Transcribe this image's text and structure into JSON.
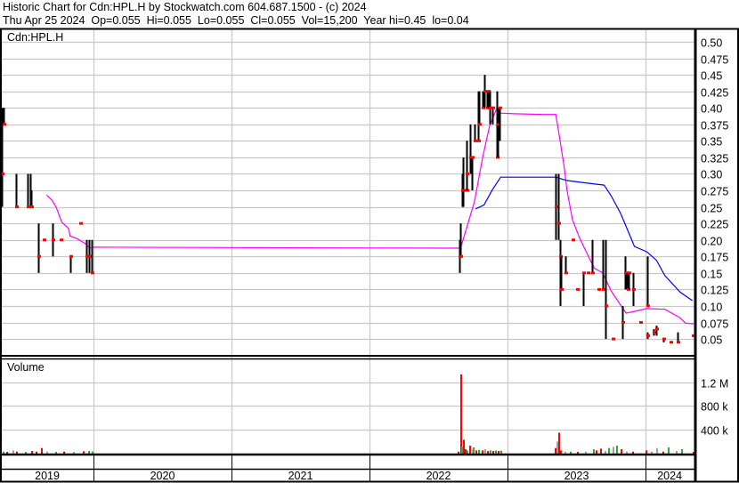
{
  "header": {
    "title": "Historic Chart for Cdn:HPL.H by Stockwatch.com 604.687.1500 - (c) 2024",
    "quote": "Thu Apr 25 2024  Op=0.055  Hi=0.055  Lo=0.055  Cl=0.055  Vol=15,200  Year hi=0.45  lo=0.04"
  },
  "colors": {
    "bar": "#000000",
    "close": "#ff0000",
    "ma_short": "#ff00ff",
    "ma_long": "#0000ff",
    "vol_down": "#ff0000",
    "vol_up": "#33aa33",
    "vol_flat": "#a0a0a0",
    "grid": "#c8c8c8"
  },
  "chart_data": [
    {
      "type": "line",
      "title": "Cdn:HPL.H",
      "x_unit": "year",
      "xlim": [
        2019.33,
        2024.35
      ],
      "ylim": [
        0.025,
        0.5
      ],
      "y_ticks": [
        "0.50",
        "0.475",
        "0.45",
        "0.425",
        "0.40",
        "0.375",
        "0.35",
        "0.325",
        "0.30",
        "0.275",
        "0.25",
        "0.225",
        "0.20",
        "0.175",
        "0.15",
        "0.125",
        "0.10",
        "0.075",
        "0.05"
      ],
      "x_ticks": [
        "2019",
        "2020",
        "2021",
        "2022",
        "2023",
        "2024"
      ],
      "ohlc_bars_year_high_low_close": [
        [
          2019.335,
          0.4,
          0.25,
          0.3
        ],
        [
          2019.35,
          0.4,
          0.375,
          0.375
        ],
        [
          2019.44,
          0.3,
          0.25,
          0.25
        ],
        [
          2019.52,
          0.3,
          0.25,
          0.25
        ],
        [
          2019.54,
          0.3,
          0.25,
          0.25
        ],
        [
          2019.55,
          0.275,
          0.25,
          0.25
        ],
        [
          2019.6,
          0.225,
          0.15,
          0.175
        ],
        [
          2019.64,
          0.2,
          0.2,
          0.2
        ],
        [
          2019.7,
          0.225,
          0.175,
          0.2
        ],
        [
          2019.76,
          0.2,
          0.2,
          0.2
        ],
        [
          2019.83,
          0.175,
          0.15,
          0.175
        ],
        [
          2019.9,
          0.225,
          0.225,
          0.225
        ],
        [
          2019.95,
          0.2,
          0.15,
          0.175
        ],
        [
          2019.97,
          0.2,
          0.15,
          0.175
        ],
        [
          2019.99,
          0.2,
          0.15,
          0.15
        ],
        [
          2022.65,
          0.2,
          0.15,
          0.175
        ],
        [
          2022.66,
          0.225,
          0.175,
          0.175
        ],
        [
          2022.67,
          0.3,
          0.25,
          0.275
        ],
        [
          2022.68,
          0.325,
          0.25,
          0.275
        ],
        [
          2022.7,
          0.35,
          0.275,
          0.275
        ],
        [
          2022.705,
          0.35,
          0.275,
          0.3
        ],
        [
          2022.73,
          0.375,
          0.3,
          0.325
        ],
        [
          2022.74,
          0.325,
          0.275,
          0.325
        ],
        [
          2022.76,
          0.375,
          0.35,
          0.35
        ],
        [
          2022.79,
          0.425,
          0.35,
          0.35
        ],
        [
          2022.795,
          0.425,
          0.375,
          0.375
        ],
        [
          2022.82,
          0.425,
          0.4,
          0.4
        ],
        [
          2022.83,
          0.45,
          0.4,
          0.425
        ],
        [
          2022.85,
          0.425,
          0.4,
          0.4
        ],
        [
          2022.86,
          0.425,
          0.4,
          0.425
        ],
        [
          2022.87,
          0.425,
          0.375,
          0.4
        ],
        [
          2022.89,
          0.4,
          0.375,
          0.4
        ],
        [
          2022.92,
          0.425,
          0.325,
          0.325
        ],
        [
          2022.93,
          0.4,
          0.325,
          0.375
        ],
        [
          2022.94,
          0.4,
          0.35,
          0.4
        ],
        [
          2023.35,
          0.3,
          0.2,
          0.25
        ],
        [
          2023.37,
          0.3,
          0.2,
          0.225
        ],
        [
          2023.38,
          0.2,
          0.1,
          0.175
        ],
        [
          2023.39,
          0.175,
          0.125,
          0.125
        ],
        [
          2023.42,
          0.175,
          0.15,
          0.15
        ],
        [
          2023.47,
          0.2,
          0.2,
          0.2
        ],
        [
          2023.5,
          0.125,
          0.125,
          0.125
        ],
        [
          2023.55,
          0.15,
          0.1,
          0.15
        ],
        [
          2023.58,
          0.15,
          0.15,
          0.15
        ],
        [
          2023.61,
          0.2,
          0.15,
          0.15
        ],
        [
          2023.66,
          0.125,
          0.125,
          0.125
        ],
        [
          2023.69,
          0.2,
          0.125,
          0.125
        ],
        [
          2023.71,
          0.2,
          0.05,
          0.1
        ],
        [
          2023.76,
          0.05,
          0.05,
          0.05
        ],
        [
          2023.83,
          0.1,
          0.05,
          0.075
        ],
        [
          2023.85,
          0.175,
          0.125,
          0.15
        ],
        [
          2023.86,
          0.15,
          0.125,
          0.15
        ],
        [
          2023.87,
          0.15,
          0.125,
          0.125
        ],
        [
          2023.88,
          0.15,
          0.125,
          0.15
        ],
        [
          2023.91,
          0.15,
          0.1,
          0.125
        ],
        [
          2023.96,
          0.075,
          0.075,
          0.075
        ],
        [
          2024.01,
          0.175,
          0.1,
          0.1
        ],
        [
          2024.015,
          0.06,
          0.05,
          0.055
        ],
        [
          2024.06,
          0.065,
          0.055,
          0.06
        ],
        [
          2024.08,
          0.07,
          0.055,
          0.065
        ],
        [
          2024.13,
          0.05,
          0.045,
          0.05
        ],
        [
          2024.18,
          0.045,
          0.045,
          0.045
        ],
        [
          2024.23,
          0.06,
          0.045,
          0.045
        ],
        [
          2024.34,
          0.055,
          0.055,
          0.055
        ]
      ],
      "moving_average_short": [
        [
          2019.66,
          0.268
        ],
        [
          2019.7,
          0.26
        ],
        [
          2019.73,
          0.249
        ],
        [
          2019.77,
          0.227
        ],
        [
          2019.82,
          0.217
        ],
        [
          2019.83,
          0.206
        ],
        [
          2019.88,
          0.202
        ],
        [
          2019.95,
          0.193
        ],
        [
          2019.97,
          0.1875
        ],
        [
          2020.01,
          0.189
        ],
        [
          2022.55,
          0.1875
        ],
        [
          2022.66,
          0.1875
        ],
        [
          2022.76,
          0.2575
        ],
        [
          2022.82,
          0.325
        ],
        [
          2022.87,
          0.372
        ],
        [
          2022.92,
          0.398
        ],
        [
          2022.95,
          0.392
        ],
        [
          2023.05,
          0.391
        ],
        [
          2023.26,
          0.39
        ],
        [
          2023.35,
          0.39
        ],
        [
          2023.37,
          0.365
        ],
        [
          2023.41,
          0.311
        ],
        [
          2023.43,
          0.276
        ],
        [
          2023.47,
          0.231
        ],
        [
          2023.52,
          0.204
        ],
        [
          2023.6,
          0.169
        ],
        [
          2023.63,
          0.157
        ],
        [
          2023.69,
          0.15
        ],
        [
          2023.75,
          0.123
        ],
        [
          2023.82,
          0.101
        ],
        [
          2023.86,
          0.089
        ],
        [
          2024.01,
          0.096
        ],
        [
          2024.14,
          0.095
        ],
        [
          2024.25,
          0.082
        ],
        [
          2024.29,
          0.074
        ],
        [
          2024.35,
          0.073
        ]
      ],
      "moving_average_long": [
        [
          2022.77,
          0.247
        ],
        [
          2022.83,
          0.253
        ],
        [
          2022.89,
          0.276
        ],
        [
          2022.95,
          0.295
        ],
        [
          2023.35,
          0.295
        ],
        [
          2023.43,
          0.29
        ],
        [
          2023.54,
          0.287
        ],
        [
          2023.7,
          0.283
        ],
        [
          2023.75,
          0.267
        ],
        [
          2023.82,
          0.24
        ],
        [
          2023.92,
          0.19
        ],
        [
          2024.01,
          0.182
        ],
        [
          2024.08,
          0.169
        ],
        [
          2024.14,
          0.146
        ],
        [
          2024.25,
          0.121
        ],
        [
          2024.34,
          0.108
        ]
      ]
    },
    {
      "type": "bar",
      "title": "Volume",
      "x_unit": "year",
      "ylim": [
        0,
        1400000
      ],
      "y_ticks": [
        {
          "label": "1.2 M",
          "value": 1200000
        },
        {
          "label": "800 k",
          "value": 800000
        },
        {
          "label": "400 k",
          "value": 400000
        }
      ],
      "bars_year_volume_dir": [
        [
          2019.34,
          20000,
          "up"
        ],
        [
          2019.37,
          15000,
          "down"
        ],
        [
          2019.41,
          40000,
          "flat"
        ],
        [
          2019.44,
          20000,
          "down"
        ],
        [
          2019.5,
          15000,
          "up"
        ],
        [
          2019.55,
          30000,
          "down"
        ],
        [
          2019.58,
          20000,
          "down"
        ],
        [
          2019.62,
          80000,
          "down"
        ],
        [
          2019.66,
          20000,
          "flat"
        ],
        [
          2019.72,
          15000,
          "up"
        ],
        [
          2019.78,
          20000,
          "down"
        ],
        [
          2019.85,
          15000,
          "flat"
        ],
        [
          2019.92,
          25000,
          "down"
        ],
        [
          2019.96,
          30000,
          "up"
        ],
        [
          2019.99,
          20000,
          "up"
        ],
        [
          2022.64,
          20000,
          "down"
        ],
        [
          2022.655,
          1330000,
          "down"
        ],
        [
          2022.66,
          1180000,
          "down"
        ],
        [
          2022.665,
          100000,
          "up"
        ],
        [
          2022.68,
          220000,
          "down"
        ],
        [
          2022.69,
          60000,
          "down"
        ],
        [
          2022.7,
          40000,
          "up"
        ],
        [
          2022.72,
          120000,
          "down"
        ],
        [
          2022.74,
          50000,
          "flat"
        ],
        [
          2022.75,
          90000,
          "up"
        ],
        [
          2022.77,
          40000,
          "down"
        ],
        [
          2022.79,
          50000,
          "up"
        ],
        [
          2022.81,
          40000,
          "down"
        ],
        [
          2022.83,
          60000,
          "flat"
        ],
        [
          2022.85,
          30000,
          "down"
        ],
        [
          2022.87,
          40000,
          "up"
        ],
        [
          2022.89,
          30000,
          "down"
        ],
        [
          2022.91,
          40000,
          "up"
        ],
        [
          2022.93,
          30000,
          "down"
        ],
        [
          2022.95,
          35000,
          "up"
        ],
        [
          2023.34,
          80000,
          "down"
        ],
        [
          2023.355,
          190000,
          "flat"
        ],
        [
          2023.37,
          340000,
          "down"
        ],
        [
          2023.38,
          40000,
          "down"
        ],
        [
          2023.41,
          20000,
          "flat"
        ],
        [
          2023.45,
          20000,
          "up"
        ],
        [
          2023.5,
          15000,
          "down"
        ],
        [
          2023.56,
          20000,
          "flat"
        ],
        [
          2023.62,
          60000,
          "up"
        ],
        [
          2023.64,
          40000,
          "down"
        ],
        [
          2023.67,
          70000,
          "down"
        ],
        [
          2023.7,
          30000,
          "flat"
        ],
        [
          2023.73,
          80000,
          "up"
        ],
        [
          2023.76,
          100000,
          "flat"
        ],
        [
          2023.79,
          120000,
          "up"
        ],
        [
          2023.82,
          60000,
          "down"
        ],
        [
          2023.86,
          20000,
          "flat"
        ],
        [
          2023.9,
          20000,
          "down"
        ],
        [
          2024.0,
          40000,
          "down"
        ],
        [
          2024.04,
          20000,
          "flat"
        ],
        [
          2024.08,
          80000,
          "flat"
        ],
        [
          2024.12,
          20000,
          "down"
        ],
        [
          2024.16,
          90000,
          "up"
        ],
        [
          2024.22,
          30000,
          "flat"
        ],
        [
          2024.26,
          60000,
          "up"
        ],
        [
          2024.34,
          15200,
          "down"
        ]
      ]
    }
  ]
}
